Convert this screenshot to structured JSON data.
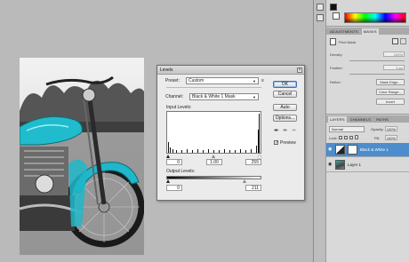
{
  "levels_dialog": {
    "title": "Levels",
    "preset_label": "Preset:",
    "preset_value": "Custom",
    "channel_label": "Channel:",
    "channel_value": "Black & White 1 Mask",
    "input_levels_label": "Input Levels:",
    "input_black": "0",
    "input_gamma": "1.00",
    "input_white": "255",
    "output_levels_label": "Output Levels:",
    "output_black": "0",
    "output_white": "211",
    "buttons": {
      "ok": "OK",
      "cancel": "Cancel",
      "auto": "Auto",
      "options": "Options..."
    },
    "preview_label": "Preview",
    "preview_checked": true,
    "preset_menu_icon": "menu-icon"
  },
  "masks_panel": {
    "tabs": [
      "ADJUSTMENTS",
      "MASKS"
    ],
    "mask_type": "Pixel Mask",
    "density_label": "Density:",
    "density_value": "100%",
    "feather_label": "Feather:",
    "feather_value": "0 px",
    "refine_label": "Refine:",
    "refine_buttons": [
      "Mask Edge...",
      "Color Range...",
      "Invert"
    ]
  },
  "layers_panel": {
    "tabs": [
      "LAYERS",
      "CHANNELS",
      "PATHS"
    ],
    "blend_mode": "Normal",
    "opacity_label": "Opacity:",
    "opacity_value": "100%",
    "lock_label": "Lock:",
    "fill_label": "Fill:",
    "fill_value": "100%",
    "layers": [
      {
        "name": "Black & White 1",
        "selected": true
      },
      {
        "name": "Layer 1",
        "selected": false
      }
    ]
  },
  "colors": {
    "selection_blue": "#4d8ccd",
    "ok_border": "#3d6fb5"
  }
}
